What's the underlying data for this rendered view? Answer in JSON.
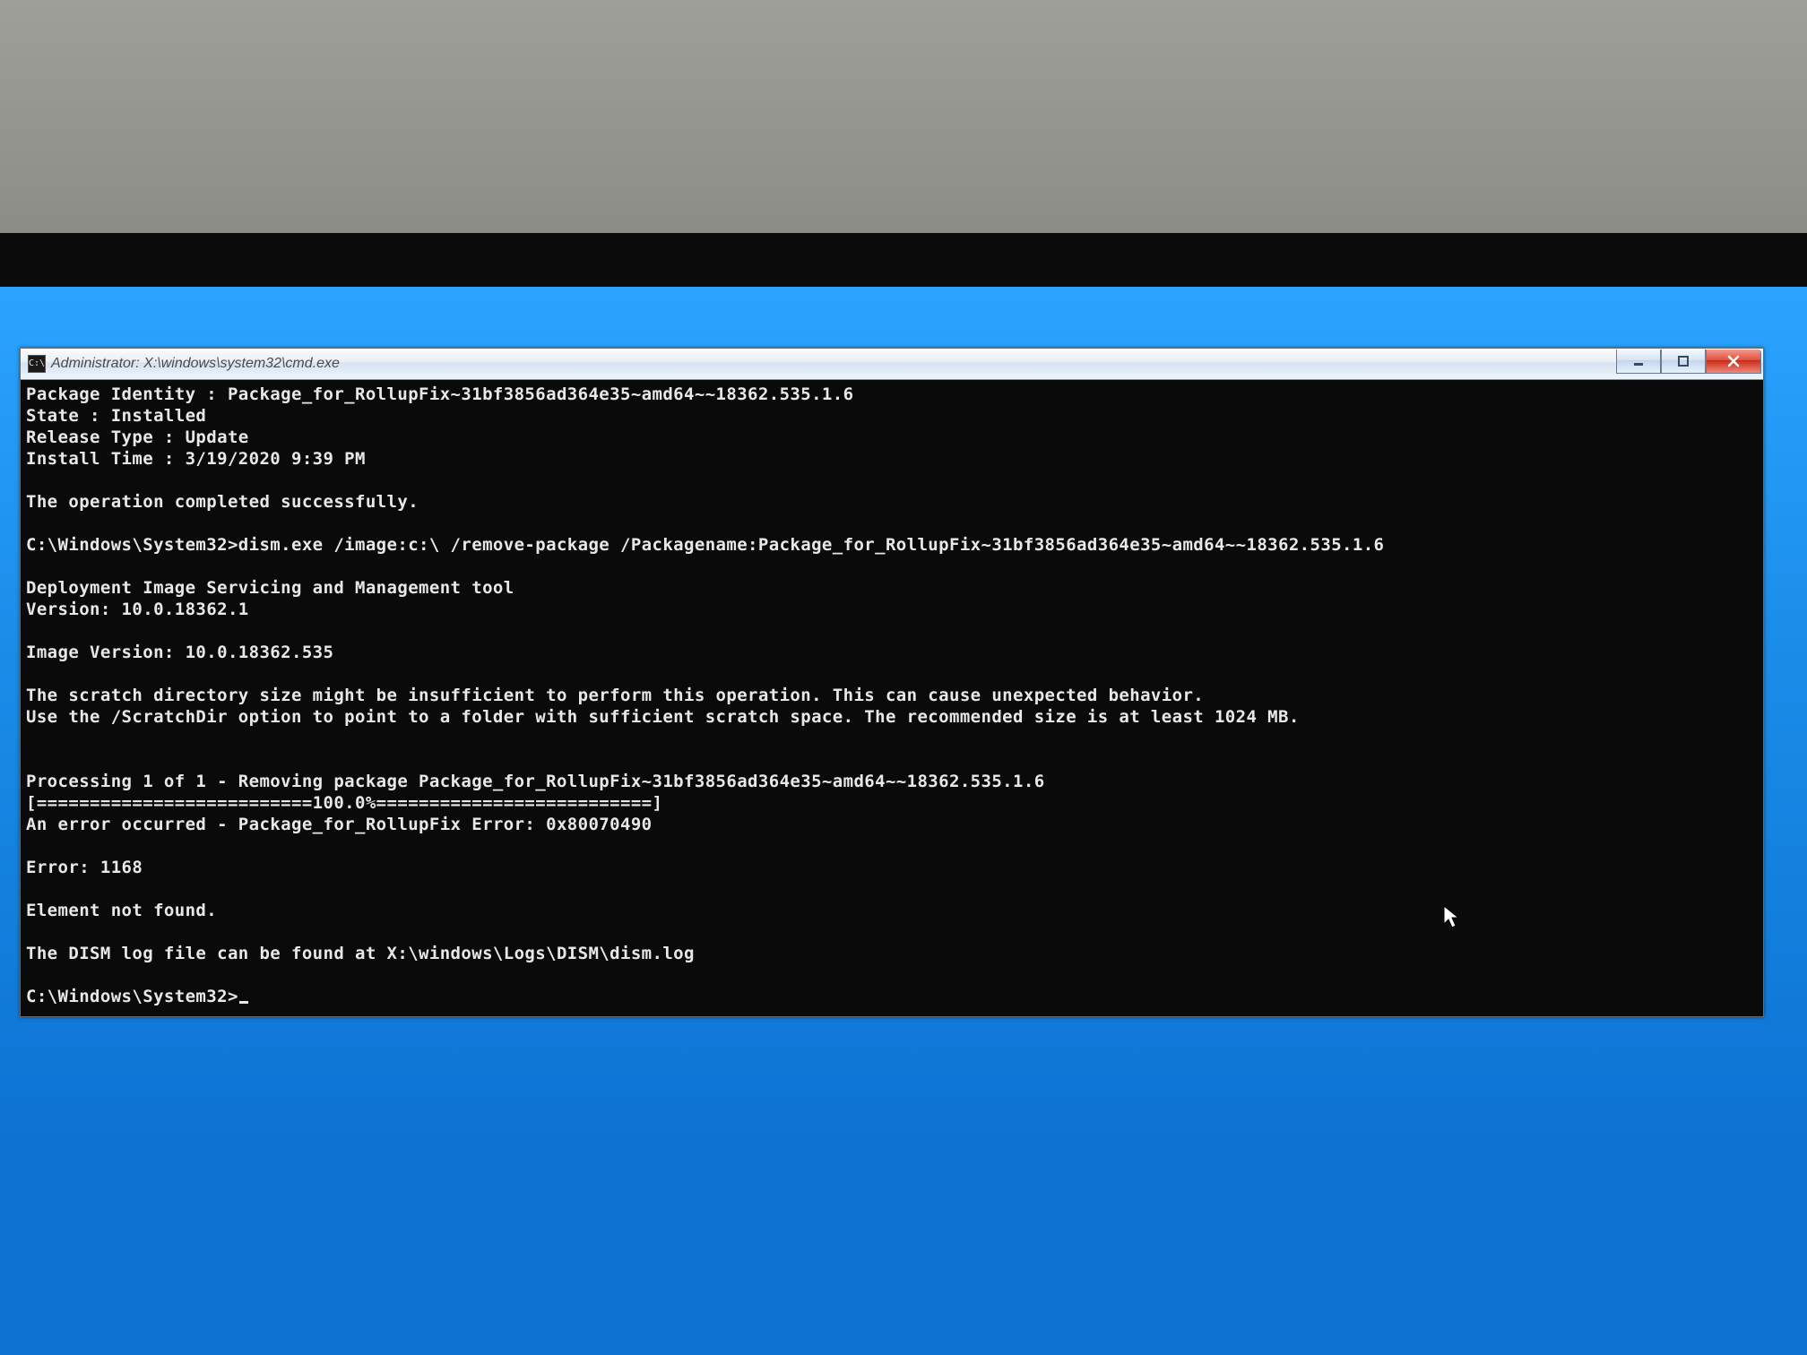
{
  "titlebar": {
    "icon_text": "C:\\",
    "title": "Administrator: X:\\windows\\system32\\cmd.exe"
  },
  "terminal": {
    "lines": [
      "Package Identity : Package_for_RollupFix~31bf3856ad364e35~amd64~~18362.535.1.6",
      "State : Installed",
      "Release Type : Update",
      "Install Time : 3/19/2020 9:39 PM",
      "",
      "The operation completed successfully.",
      "",
      "C:\\Windows\\System32>dism.exe /image:c:\\ /remove-package /Packagename:Package_for_RollupFix~31bf3856ad364e35~amd64~~18362.535.1.6",
      "",
      "Deployment Image Servicing and Management tool",
      "Version: 10.0.18362.1",
      "",
      "Image Version: 10.0.18362.535",
      "",
      "The scratch directory size might be insufficient to perform this operation. This can cause unexpected behavior.",
      "Use the /ScratchDir option to point to a folder with sufficient scratch space. The recommended size is at least 1024 MB.",
      "",
      "",
      "Processing 1 of 1 - Removing package Package_for_RollupFix~31bf3856ad364e35~amd64~~18362.535.1.6",
      "[==========================100.0%==========================]",
      "An error occurred - Package_for_RollupFix Error: 0x80070490",
      "",
      "Error: 1168",
      "",
      "Element not found.",
      "",
      "The DISM log file can be found at X:\\windows\\Logs\\DISM\\dism.log",
      ""
    ],
    "prompt": "C:\\Windows\\System32>"
  }
}
